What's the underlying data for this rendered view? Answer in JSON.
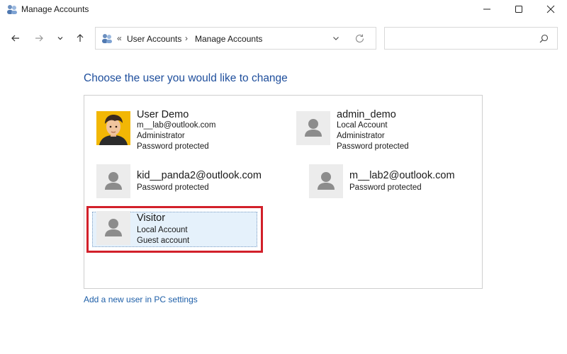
{
  "window": {
    "title": "Manage Accounts"
  },
  "address": {
    "breadcrumb_sep": "«",
    "crumbs": [
      "User Accounts",
      "Manage Accounts"
    ],
    "crumb_arrow": "›"
  },
  "search": {
    "placeholder": ""
  },
  "main": {
    "heading": "Choose the user you would like to change",
    "add_link": "Add a new user in PC settings"
  },
  "accounts": [
    {
      "name": "User Demo",
      "lines": [
        "m__lab@outlook.com",
        "Administrator",
        "Password protected"
      ],
      "picture": "cartoon-avatar"
    },
    {
      "name": "admin_demo",
      "lines": [
        "Local Account",
        "Administrator",
        "Password protected"
      ],
      "picture": "default-user-icon"
    },
    {
      "name": "kid__panda2@outlook.com",
      "lines": [
        "Password protected"
      ],
      "picture": "default-user-icon"
    },
    {
      "name": "m__lab2@outlook.com",
      "lines": [
        "Password protected"
      ],
      "picture": "default-user-icon"
    },
    {
      "name": "Visitor",
      "lines": [
        "Local Account",
        "Guest account"
      ],
      "picture": "default-user-icon",
      "selected": true
    }
  ],
  "colors": {
    "heading": "#1e4e9c",
    "link": "#1e5fa8",
    "highlight_border": "#d2202a",
    "selected_bg": "#e5f1fb"
  }
}
